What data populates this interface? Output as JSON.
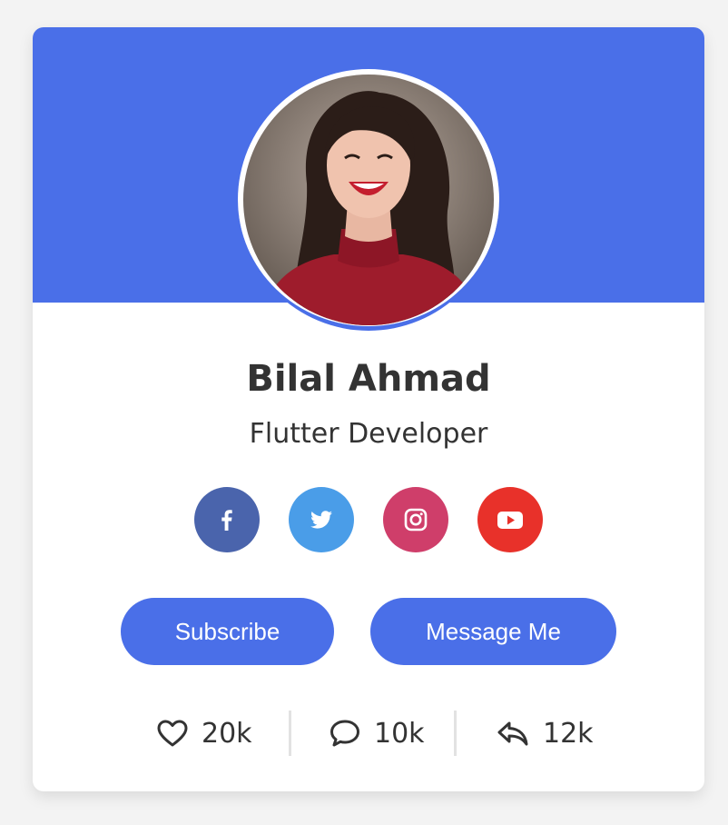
{
  "profile": {
    "name": "Bilal Ahmad",
    "role": "Flutter Developer"
  },
  "social": [
    {
      "name": "facebook",
      "icon": "facebook-icon",
      "color": "#4a64ac"
    },
    {
      "name": "twitter",
      "icon": "twitter-icon",
      "color": "#4a9de8"
    },
    {
      "name": "instagram",
      "icon": "instagram-icon",
      "color": "#cf3e6a"
    },
    {
      "name": "youtube",
      "icon": "youtube-icon",
      "color": "#e8312a"
    }
  ],
  "buttons": {
    "subscribe": "Subscribe",
    "message": "Message Me"
  },
  "stats": [
    {
      "icon": "heart-icon",
      "value": "20k"
    },
    {
      "icon": "comment-icon",
      "value": "10k"
    },
    {
      "icon": "reply-icon",
      "value": "12k"
    }
  ],
  "colors": {
    "accent": "#4a6fe8",
    "text": "#333333",
    "background": "#f3f3f3"
  }
}
